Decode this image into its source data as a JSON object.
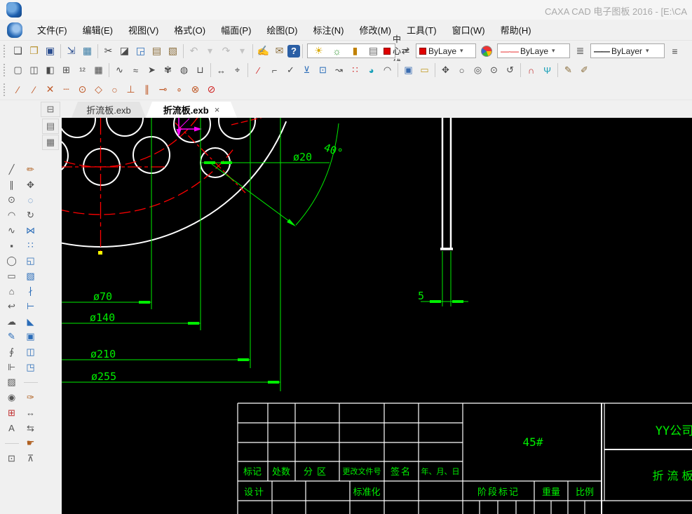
{
  "window": {
    "title": "CAXA CAD 电子图板 2016 - [E:\\CA"
  },
  "menu": {
    "items": [
      "文件(F)",
      "编辑(E)",
      "视图(V)",
      "格式(O)",
      "幅面(P)",
      "绘图(D)",
      "标注(N)",
      "修改(M)",
      "工具(T)",
      "窗口(W)",
      "帮助(H)"
    ]
  },
  "ui": {
    "caret": "▾",
    "help_glyph": "?",
    "more_glyph": "≡"
  },
  "toolbar": {
    "layer_combo": {
      "value": "中心线"
    },
    "color_combo": {
      "value": "ByLaye"
    },
    "linetype_combo": {
      "value": "ByLaye",
      "sample": "—·—"
    },
    "linewidth_combo": {
      "value": "ByLayer",
      "sample": "——"
    },
    "row1_icons": [
      {
        "n": "new-file-icon",
        "g": "❏"
      },
      {
        "n": "open-file-icon",
        "g": "❐",
        "c": "#b8912f"
      },
      {
        "n": "save-file-icon",
        "g": "▣",
        "c": "#2a4d8f"
      },
      {
        "sep": true
      },
      {
        "n": "save-as-icon",
        "g": "⇲",
        "c": "#2a4d8f"
      },
      {
        "n": "print-icon",
        "g": "▦",
        "c": "#3a7ca5"
      },
      {
        "sep": true
      },
      {
        "n": "cut-icon",
        "g": "✂"
      },
      {
        "n": "copy-icon",
        "g": "◪"
      },
      {
        "n": "copy-with-base-icon",
        "g": "◲",
        "c": "#2a6cb8"
      },
      {
        "n": "paste-icon",
        "g": "▤",
        "c": "#8a6d3b"
      },
      {
        "n": "paste-special-icon",
        "g": "▧",
        "c": "#8a6d3b"
      },
      {
        "sep": true
      },
      {
        "n": "undo-icon",
        "g": "↶",
        "c": "#b8b8b8"
      },
      {
        "n": "undo-caret-icon",
        "g": "▾",
        "c": "#c4c4c4"
      },
      {
        "n": "redo-icon",
        "g": "↷",
        "c": "#b8b8b8"
      },
      {
        "n": "redo-caret-icon",
        "g": "▾",
        "c": "#c4c4c4"
      },
      {
        "sep": true
      },
      {
        "n": "clean-document-icon",
        "g": "✍",
        "c": "#b8860b"
      },
      {
        "n": "ole-object-icon",
        "g": "✉",
        "c": "#8a6d3b"
      }
    ],
    "layer_state_icons": [
      {
        "n": "layer-visible-bulb-icon",
        "g": "☀",
        "c": "#d9a800"
      },
      {
        "n": "layer-frozen-sun-icon",
        "g": "☼",
        "c": "#3a9a3a"
      },
      {
        "n": "layer-lock-icon",
        "g": "▮",
        "c": "#c08000"
      },
      {
        "n": "layer-print-icon",
        "g": "▤",
        "c": "#666"
      }
    ],
    "row2_icons": [
      {
        "n": "paper-frame-icon",
        "g": "▢"
      },
      {
        "n": "title-block-icon",
        "g": "◫"
      },
      {
        "n": "paper-edge-icon",
        "g": "◧"
      },
      {
        "n": "table-icon",
        "g": "⊞"
      },
      {
        "n": "serial-number-icon",
        "g": "¹²"
      },
      {
        "n": "bom-table-icon",
        "g": "▦"
      },
      {
        "sep": true
      },
      {
        "n": "wavy-line-icon",
        "g": "∿"
      },
      {
        "n": "break-line-icon",
        "g": "≈"
      },
      {
        "n": "leader-arrow-icon",
        "g": "➤"
      },
      {
        "n": "gear-symbol-icon",
        "g": "✾"
      },
      {
        "n": "balloon-icon",
        "g": "◍"
      },
      {
        "n": "part-view-icon",
        "g": "⊔"
      },
      {
        "sep": true
      },
      {
        "n": "dim-linear-icon",
        "g": "↔"
      },
      {
        "n": "dim-coordinate-icon",
        "g": "⌖"
      },
      {
        "sep": true
      },
      {
        "n": "red-slash-icon",
        "g": "∕",
        "c": "#d02020"
      },
      {
        "n": "fillet-dim-icon",
        "g": "⌐"
      },
      {
        "n": "check-dim-icon",
        "g": "✓"
      },
      {
        "n": "datum-symbol-icon",
        "g": "⊻",
        "c": "#2a6cb8"
      },
      {
        "n": "tolerance-box-icon",
        "g": "⊡",
        "c": "#2a6cb8"
      },
      {
        "n": "chain-dim-icon",
        "g": "↝"
      },
      {
        "n": "red-marks-icon",
        "g": "∷",
        "c": "#d02020"
      },
      {
        "n": "quadrant-circle-icon",
        "g": "◕",
        "c": "#18a0b8"
      },
      {
        "n": "arc-angle-icon",
        "g": "◠"
      },
      {
        "sep": true
      },
      {
        "n": "screen-icon",
        "g": "▣",
        "c": "#3a6cb0"
      },
      {
        "n": "ruler-icon",
        "g": "▭",
        "c": "#c09a20"
      },
      {
        "sep": true
      },
      {
        "n": "pan-icon",
        "g": "✥"
      },
      {
        "n": "zoom-icon",
        "g": "○"
      },
      {
        "n": "zoom-window-icon",
        "g": "◎"
      },
      {
        "n": "zoom-all-icon",
        "g": "⊙"
      },
      {
        "n": "zoom-back-icon",
        "g": "↺"
      },
      {
        "sep": true
      },
      {
        "n": "magnet-icon",
        "g": "∩",
        "c": "#c03030"
      },
      {
        "n": "snap-guide-icon",
        "g": "Ψ",
        "c": "#18a0b8"
      },
      {
        "sep": true
      },
      {
        "n": "sketch-pen-icon",
        "g": "✎",
        "c": "#8a6d3b"
      },
      {
        "n": "font-tool-icon",
        "g": "✐",
        "c": "#8a6d3b"
      }
    ],
    "row3_icons": [
      {
        "n": "snap-endpoint-icon",
        "g": "∕"
      },
      {
        "n": "snap-midpoint-icon",
        "g": "∕"
      },
      {
        "n": "snap-intersection-icon",
        "g": "✕"
      },
      {
        "n": "snap-dash-icon",
        "g": "┄"
      },
      {
        "n": "snap-center-icon",
        "g": "⊙"
      },
      {
        "n": "snap-quadrant-icon",
        "g": "◇"
      },
      {
        "n": "snap-tangent-circle-icon",
        "g": "○"
      },
      {
        "n": "snap-perpendicular-icon",
        "g": "⊥"
      },
      {
        "n": "snap-parallel-icon",
        "g": "∥"
      },
      {
        "n": "snap-nearest-icon",
        "g": "⊸"
      },
      {
        "n": "snap-node-icon",
        "g": "∘"
      },
      {
        "n": "snap-tangent-point-icon",
        "g": "⊗"
      },
      {
        "n": "snap-off-icon",
        "g": "⊘",
        "c": "#d02020"
      }
    ],
    "left_icons": [
      {
        "n": "draw-line-icon",
        "g": "╱"
      },
      {
        "n": "erase-icon",
        "g": "✏",
        "c": "#b06020"
      },
      {
        "n": "draw-parallel-icon",
        "g": "∥"
      },
      {
        "n": "move-icon",
        "g": "✥"
      },
      {
        "n": "draw-circle-icon",
        "g": "⊙"
      },
      {
        "n": "copy-object-icon",
        "g": "◌",
        "c": "#2a6cb8"
      },
      {
        "n": "draw-arc-icon",
        "g": "◠"
      },
      {
        "n": "rotate-icon",
        "g": "↻"
      },
      {
        "n": "draw-spline-icon",
        "g": "∿"
      },
      {
        "n": "mirror-icon",
        "g": "⋈",
        "c": "#2a6cb8"
      },
      {
        "n": "draw-point-icon",
        "g": "▪"
      },
      {
        "n": "array-icon",
        "g": "∷",
        "c": "#2a6cb8"
      },
      {
        "n": "draw-ellipse-icon",
        "g": "◯"
      },
      {
        "n": "scale-icon",
        "g": "◱",
        "c": "#2a6cb8"
      },
      {
        "n": "draw-rectangle-icon",
        "g": "▭"
      },
      {
        "n": "stretch-icon",
        "g": "▧",
        "c": "#2a6cb8"
      },
      {
        "n": "draw-polygon-icon",
        "g": "⌂"
      },
      {
        "n": "break-icon",
        "g": "∤",
        "c": "#2a6cb8"
      },
      {
        "n": "draw-hook-icon",
        "g": "↩"
      },
      {
        "n": "extend-icon",
        "g": "⊢",
        "c": "#2a6cb8"
      },
      {
        "n": "draw-cloud-icon",
        "g": "☁"
      },
      {
        "n": "chamfer-icon",
        "g": "◣",
        "c": "#2a6cb8"
      },
      {
        "n": "draw-sketch-icon",
        "g": "✎",
        "c": "#2a6cb8"
      },
      {
        "n": "crop-box-icon",
        "g": "▣",
        "c": "#2a6cb8"
      },
      {
        "n": "draw-contour-icon",
        "g": "∮"
      },
      {
        "n": "frame-edit-icon",
        "g": "◫",
        "c": "#2a6cb8"
      },
      {
        "n": "draw-axis-icon",
        "g": "⊩"
      },
      {
        "n": "view-3d-icon",
        "g": "◳",
        "c": "#2a6cb8"
      },
      {
        "n": "draw-hatch-icon",
        "g": "▨"
      },
      {
        "sep": true
      },
      {
        "n": "stamp-icon",
        "g": "◉"
      },
      {
        "n": "dim-edit-icon",
        "g": "✑",
        "c": "#b06020"
      },
      {
        "n": "table-insert-icon",
        "g": "⊞",
        "c": "#c03030"
      },
      {
        "n": "dim-tool-icon",
        "g": "↔"
      },
      {
        "n": "draw-text-icon",
        "g": "A"
      },
      {
        "n": "dim-chain-icon",
        "g": "⇆"
      },
      {
        "sep": true
      },
      {
        "n": "pick-tool-icon",
        "g": "☛",
        "c": "#b06020"
      },
      {
        "n": "block-icon",
        "g": "⊡"
      },
      {
        "n": "bolt-tool-icon",
        "g": "⊼"
      }
    ],
    "side_panel_icons": [
      {
        "n": "overlay-toolbar-icon",
        "g": "⊟",
        "c": "#b06020"
      },
      {
        "n": "properties-panel-icon",
        "g": "▤"
      },
      {
        "n": "library-panel-icon",
        "g": "▦"
      }
    ]
  },
  "tabs": {
    "items": [
      {
        "label": "折流板.exb"
      },
      {
        "label": "折流板.exb"
      }
    ],
    "close_glyph": "×"
  },
  "drawing": {
    "labels": {
      "d20": "ø20",
      "a40": "40°",
      "d70": "ø70",
      "d140": "ø140",
      "d210": "ø210",
      "d255": "ø255",
      "t5": "5"
    },
    "colors": {
      "background": "#000000",
      "geometry": "#ffffff",
      "centerline": "#ff0000",
      "dimension": "#00ee00",
      "highlight": "#ff00ff",
      "point_marker": "#ffff00"
    }
  },
  "title_block": {
    "material": "45#",
    "company": "YY公司",
    "part_name": "折流板",
    "change_headers": [
      "标记",
      "处数",
      "分区",
      "更改文件号",
      "签名",
      "年、月、日"
    ],
    "row_design": "设计",
    "row_standard": "标准化",
    "stage_label": "阶段标记",
    "weight_label": "重量",
    "scale_label": "比例"
  }
}
